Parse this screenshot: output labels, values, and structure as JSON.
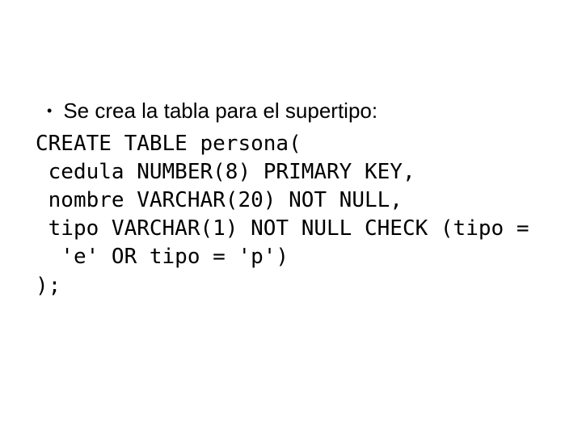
{
  "bullet_text": "Se crea la tabla para el supertipo:",
  "code": {
    "l1": "CREATE TABLE persona(",
    "l2": " cedula NUMBER(8) PRIMARY KEY,",
    "l3": " nombre VARCHAR(20) NOT NULL,",
    "l4": " tipo VARCHAR(1) NOT NULL CHECK (tipo =",
    "l5": "  'e' OR tipo = 'p')",
    "l6": ");"
  }
}
